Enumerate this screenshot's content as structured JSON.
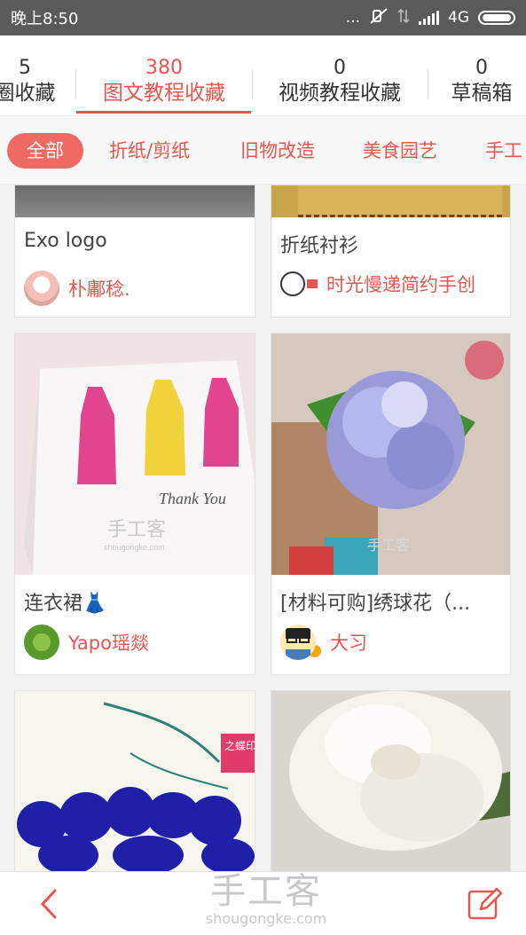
{
  "status_bar": {
    "time": "晚上8:50",
    "network": "4G",
    "dots": "..."
  },
  "count_tabs": [
    {
      "count": "5",
      "label": "圈收藏"
    },
    {
      "count": "380",
      "label": "图文教程收藏"
    },
    {
      "count": "0",
      "label": "视频教程收藏"
    },
    {
      "count": "0",
      "label": "草稿箱"
    }
  ],
  "categories": [
    "全部",
    "折纸/剪纸",
    "旧物改造",
    "美食园艺",
    "手工"
  ],
  "cards": [
    {
      "title": "Exo  logo",
      "author": "朴鄘稔."
    },
    {
      "title": "折纸衬衫",
      "author": "时光慢递简约手创"
    },
    {
      "title": "连衣裙👗",
      "author": "Yapo瑶燚"
    },
    {
      "title": "[材料可购]绣球花（...",
      "author": "大习"
    },
    {
      "title": "",
      "author": ""
    },
    {
      "title": "",
      "author": ""
    }
  ],
  "image_text": {
    "thank_you": "Thank You",
    "watermark_cn": "手工客",
    "watermark_url": "shougongke.com",
    "stamp": "之蝶印变"
  },
  "bottom_bar": {
    "watermark_cn": "手工客",
    "watermark_url": "shougongke.com"
  },
  "colors": {
    "accent": "#e8554e",
    "chip_active": "#ef6a63",
    "status_bar": "#5a5a5a"
  },
  "icons": [
    "back-arrow-icon",
    "edit-icon",
    "mute-icon",
    "signal-icon",
    "battery-icon"
  ]
}
